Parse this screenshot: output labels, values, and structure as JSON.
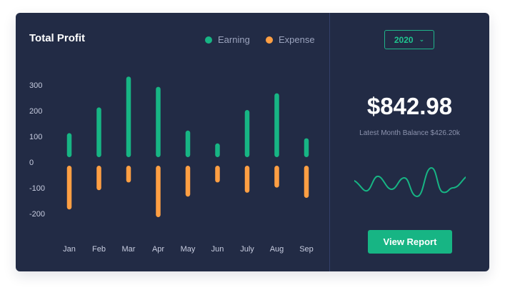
{
  "header": {
    "title": "Total Profit"
  },
  "legend": [
    {
      "label": "Earning",
      "color": "#17b584"
    },
    {
      "label": "Expense",
      "color": "#ff9f43"
    }
  ],
  "chart_data": {
    "type": "bar",
    "categories": [
      "Jan",
      "Feb",
      "Mar",
      "Apr",
      "May",
      "Jun",
      "July",
      "Aug",
      "Sep"
    ],
    "series": [
      {
        "name": "Earning",
        "color": "#17b584",
        "values": [
          110,
          210,
          330,
          290,
          120,
          70,
          200,
          265,
          90
        ]
      },
      {
        "name": "Expense",
        "color": "#ff9f43",
        "values": [
          -170,
          -95,
          -65,
          -200,
          -120,
          -65,
          -105,
          -85,
          -125
        ]
      }
    ],
    "ylim": [
      -200,
      300
    ],
    "yticks": [
      300,
      200,
      100,
      0,
      -100,
      -200
    ],
    "grid": false,
    "legend_position": "top-right"
  },
  "right": {
    "year": "2020",
    "balance": "$842.98",
    "sub": "Latest Month Balance $426.20k",
    "button": "View Report",
    "accent": "#17b584"
  }
}
